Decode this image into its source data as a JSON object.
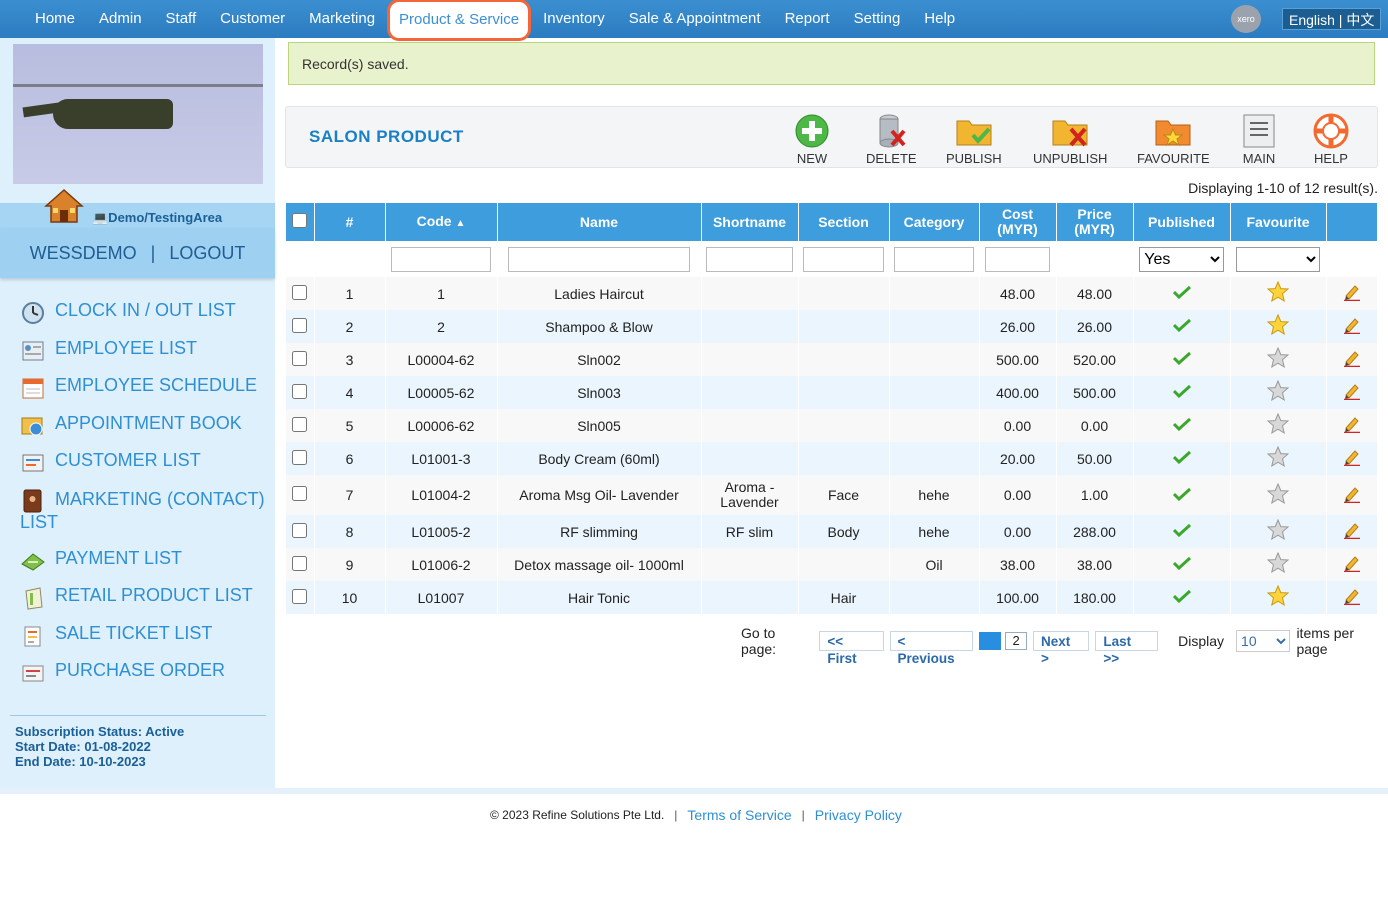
{
  "nav": {
    "items": [
      "Home",
      "Admin",
      "Staff",
      "Customer",
      "Marketing",
      "Product & Service",
      "Inventory",
      "Sale & Appointment",
      "Report",
      "Setting",
      "Help"
    ],
    "active": "Product & Service",
    "xero": "xero",
    "language": "English | 中文"
  },
  "sidebar": {
    "demo_label": "💻Demo/TestingArea",
    "username": "WESSDEMO",
    "separator": "|",
    "logout": "LOGOUT",
    "menu": [
      "CLOCK IN / OUT LIST",
      "EMPLOYEE LIST",
      "EMPLOYEE SCHEDULE",
      "APPOINTMENT BOOK",
      "CUSTOMER LIST",
      "MARKETING (CONTACT) LIST",
      "PAYMENT LIST",
      "RETAIL PRODUCT LIST",
      "SALE TICKET LIST",
      "PURCHASE ORDER"
    ],
    "subscription": {
      "status": "Subscription Status: Active",
      "start": "Start Date: 01-08-2022",
      "end": "End Date: 10-10-2023"
    }
  },
  "notice": "Record(s) saved.",
  "panel": {
    "title": "SALON PRODUCT",
    "toolbar": [
      "NEW",
      "DELETE",
      "PUBLISH",
      "UNPUBLISH",
      "FAVOURITE",
      "MAIN",
      "HELP"
    ]
  },
  "results_text": "Displaying 1-10 of 12 result(s).",
  "table": {
    "columns": [
      "#",
      "Code",
      "Name",
      "Shortname",
      "Section",
      "Category",
      "Cost (MYR)",
      "Price (MYR)",
      "Published",
      "Favourite"
    ],
    "sort_indicator": "▲",
    "filter_published": "Yes",
    "filter_favourite": "",
    "rows": [
      {
        "n": "1",
        "code": "1",
        "name": "Ladies Haircut",
        "short": "",
        "section": "",
        "category": "",
        "cost": "48.00",
        "price": "48.00",
        "published": true,
        "favourite": true
      },
      {
        "n": "2",
        "code": "2",
        "name": "Shampoo & Blow",
        "short": "",
        "section": "",
        "category": "",
        "cost": "26.00",
        "price": "26.00",
        "published": true,
        "favourite": true
      },
      {
        "n": "3",
        "code": "L00004-62",
        "name": "Sln002",
        "short": "",
        "section": "",
        "category": "",
        "cost": "500.00",
        "price": "520.00",
        "published": true,
        "favourite": false
      },
      {
        "n": "4",
        "code": "L00005-62",
        "name": "Sln003",
        "short": "",
        "section": "",
        "category": "",
        "cost": "400.00",
        "price": "500.00",
        "published": true,
        "favourite": false
      },
      {
        "n": "5",
        "code": "L00006-62",
        "name": "Sln005",
        "short": "",
        "section": "",
        "category": "",
        "cost": "0.00",
        "price": "0.00",
        "published": true,
        "favourite": false
      },
      {
        "n": "6",
        "code": "L01001-3",
        "name": "Body Cream (60ml)",
        "short": "",
        "section": "",
        "category": "",
        "cost": "20.00",
        "price": "50.00",
        "published": true,
        "favourite": false
      },
      {
        "n": "7",
        "code": "L01004-2",
        "name": "Aroma Msg Oil- Lavender",
        "short": "Aroma - Lavender",
        "section": "Face",
        "category": "hehe",
        "cost": "0.00",
        "price": "1.00",
        "published": true,
        "favourite": false
      },
      {
        "n": "8",
        "code": "L01005-2",
        "name": "RF slimming",
        "short": "RF slim",
        "section": "Body",
        "category": "hehe",
        "cost": "0.00",
        "price": "288.00",
        "published": true,
        "favourite": false
      },
      {
        "n": "9",
        "code": "L01006-2",
        "name": "Detox massage oil- 1000ml",
        "short": "",
        "section": "",
        "category": "Oil",
        "cost": "38.00",
        "price": "38.00",
        "published": true,
        "favourite": false
      },
      {
        "n": "10",
        "code": "L01007",
        "name": "Hair Tonic",
        "short": "",
        "section": "Hair",
        "category": "",
        "cost": "100.00",
        "price": "180.00",
        "published": true,
        "favourite": true
      }
    ]
  },
  "pager": {
    "goto_label": "Go to page:",
    "first": "<< First",
    "previous": "< Previous",
    "pages": [
      "1",
      "2"
    ],
    "current": "1",
    "next": "Next >",
    "last": "Last >>",
    "display_label": "Display",
    "per_page": "10",
    "per_page_label": "items per page"
  },
  "footer": {
    "copyright": "© 2023 Refine Solutions Pte Ltd.",
    "separator": "|",
    "terms": "Terms of Service",
    "privacy": "Privacy Policy"
  }
}
